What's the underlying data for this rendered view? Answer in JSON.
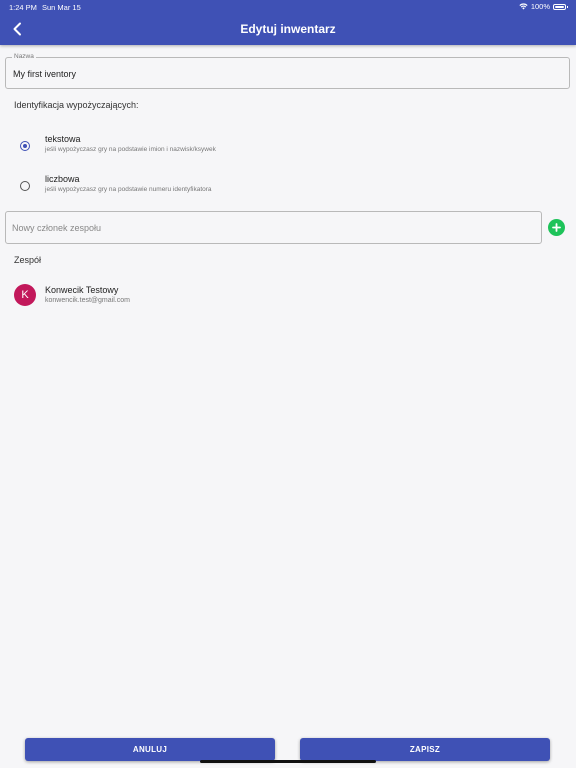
{
  "status_bar": {
    "time": "1:24 PM",
    "date": "Sun Mar 15",
    "battery": "100%"
  },
  "app_bar": {
    "title": "Edytuj inwentarz",
    "back_icon": "chevron-left-icon"
  },
  "name_field": {
    "label": "Nazwa",
    "value": "My first iventory"
  },
  "identification": {
    "label": "Identyfikacja wypożyczających:",
    "options": [
      {
        "title": "tekstowa",
        "description": "jeśli wypożyczasz gry na podstawie imion i nazwisk/ksywek",
        "selected": true
      },
      {
        "title": "liczbowa",
        "description": "jeśli wypożyczasz gry na podstawie numeru identyfikatora",
        "selected": false
      }
    ]
  },
  "new_member": {
    "placeholder": "Nowy członek zespołu",
    "add_icon": "plus-circle-icon",
    "add_color": "#1ec35a"
  },
  "team": {
    "label": "Zespół",
    "members": [
      {
        "initial": "K",
        "name": "Konwecik Testowy",
        "email": "konwencik.test@gmail.com",
        "avatar_color": "#c2185b"
      }
    ]
  },
  "actions": {
    "cancel_label": "ANULUJ",
    "save_label": "ZAPISZ"
  },
  "colors": {
    "primary": "#3f51b5",
    "background": "#f6f6f8"
  }
}
